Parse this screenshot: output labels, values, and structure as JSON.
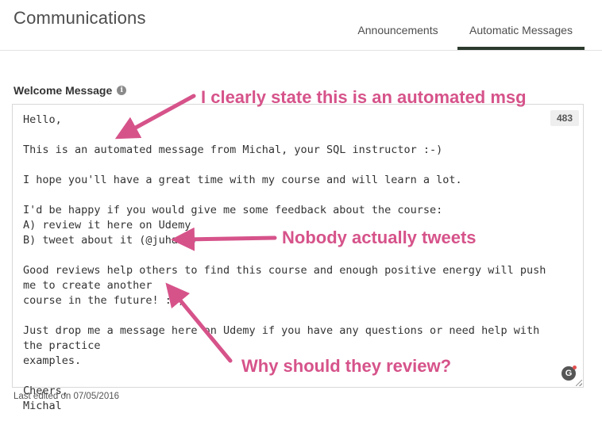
{
  "header": {
    "title": "Communications",
    "tabs": [
      {
        "label": "Announcements",
        "active": false
      },
      {
        "label": "Automatic Messages",
        "active": true
      }
    ]
  },
  "welcome": {
    "label": "Welcome Message",
    "info_icon": "info-icon",
    "char_count": "483",
    "message": "Hello,\n\nThis is an automated message from Michal, your SQL instructor :-)\n\nI hope you'll have a great time with my course and will learn a lot.\n\nI'd be happy if you would give me some feedback about the course:\nA) review it here on Udemy\nB) tweet about it (@juhasm)\n\nGood reviews help others to find this course and enough positive energy will push me to create another\ncourse in the future! :-)\n\nJust drop me a message here on Udemy if you have any questions or need help with the practice\nexamples.\n\nCheers,\nMichal",
    "grammarly_icon": "grammarly-icon",
    "last_edited": "Last edited on 07/05/2016"
  },
  "annotations": [
    {
      "text": "I clearly state this is an automated msg",
      "color": "#d6538a"
    },
    {
      "text": "Nobody actually tweets",
      "color": "#d6538a"
    },
    {
      "text": "Why should they review?",
      "color": "#d6538a"
    }
  ],
  "colors": {
    "active_tab_underline": "#2b3a2c",
    "annotation": "#d6538a"
  }
}
